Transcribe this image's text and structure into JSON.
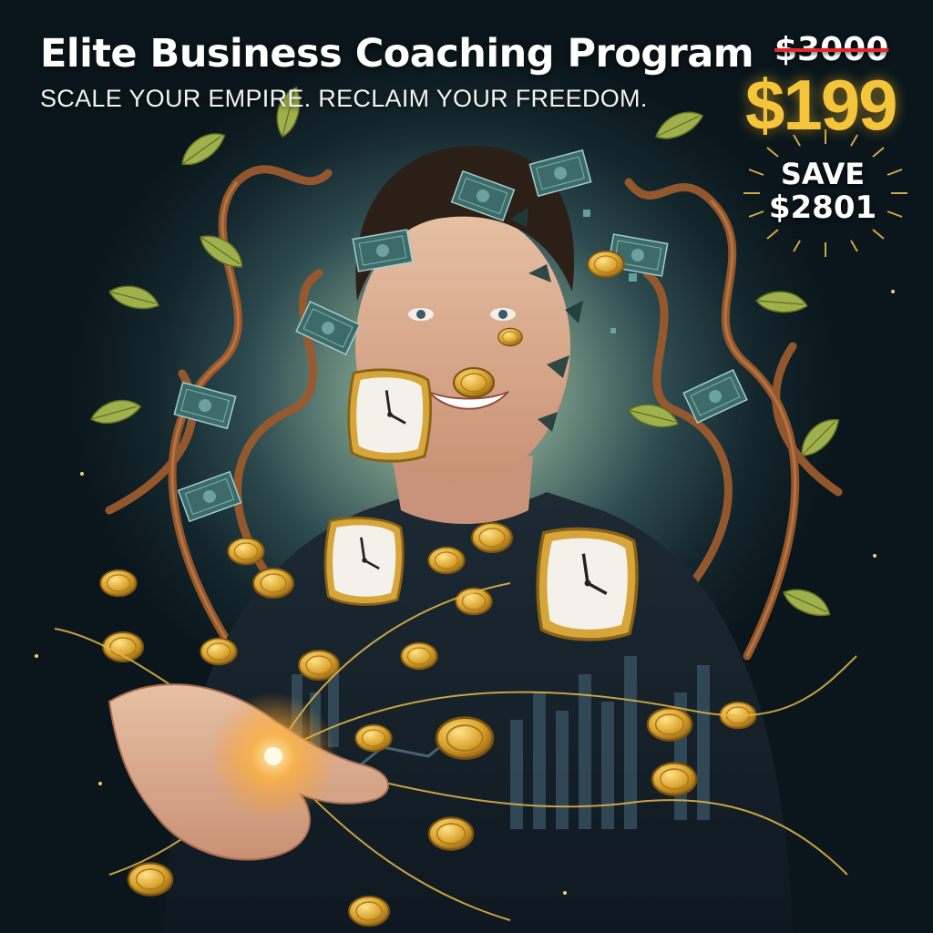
{
  "ad": {
    "title": "Elite Business Coaching Program",
    "tagline": "SCALE YOUR EMPIRE. RECLAIM YOUR FREEDOM.",
    "old_price": "$3000",
    "new_price": "$199",
    "save_label": "SAVE",
    "save_amount": "$2801"
  },
  "colors": {
    "accent_gold": "#f4c43b",
    "strike_red": "#e3262a",
    "background_dark": "#0b1a1f"
  },
  "icons": [
    "clock-icon",
    "coin-icon",
    "banknote-icon",
    "leaf-icon",
    "sparkle-icon",
    "starburst-icon"
  ]
}
